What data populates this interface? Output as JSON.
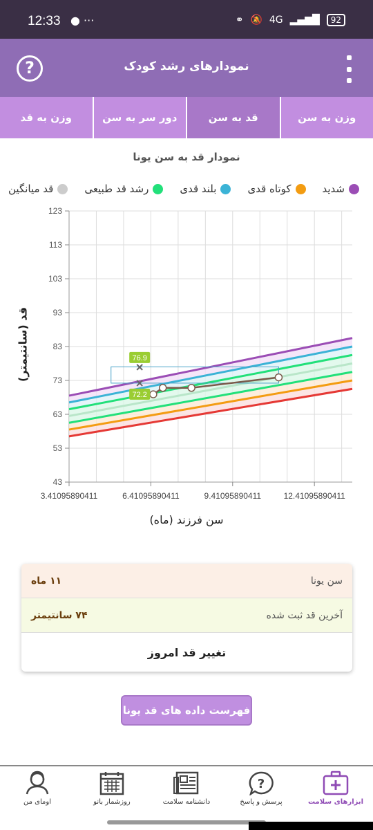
{
  "status_bar": {
    "time": "12:33",
    "left_icons": "● ···",
    "network": "4G",
    "battery": "92"
  },
  "app_bar": {
    "title": "نمودارهای رشد کودک",
    "help_glyph": "?",
    "help_icon": "help-circle-icon",
    "menu_icon": "more-vertical-icon"
  },
  "tabs": [
    {
      "label": "وزن به سن",
      "active": false
    },
    {
      "label": "قد به سن",
      "active": true
    },
    {
      "label": "دور سر به سن",
      "active": false
    },
    {
      "label": "وزن به قد",
      "active": false
    }
  ],
  "chart_title": "نمودار قد به سن یونا",
  "legend": [
    {
      "label": "شدید",
      "color": "#9b4db5"
    },
    {
      "label": "کوتاه قدی",
      "color": "#f39c12"
    },
    {
      "label": "بلند قدی",
      "color": "#3bb3d6"
    },
    {
      "label": "رشد قد طبیعی",
      "color": "#22e07a"
    },
    {
      "label": "قد میانگین",
      "color": "#cccccc"
    }
  ],
  "chart_data": {
    "type": "line",
    "xlabel": "سن فرزند (ماه)",
    "ylabel": "قد (سانتیمتر)",
    "xlim": [
      3.41095890411,
      13.8
    ],
    "ylim": [
      43,
      123
    ],
    "x_ticks": [
      "3.41095890411",
      "6.41095890411",
      "9.41095890411",
      "12.41095890411"
    ],
    "x_tick_values": [
      3.41095890411,
      6.41095890411,
      9.41095890411,
      12.41095890411
    ],
    "y_ticks": [
      43,
      53,
      63,
      73,
      83,
      93,
      103,
      113,
      123
    ],
    "grid": true,
    "reference_curves": [
      {
        "color": "#9b4db5",
        "x": [
          3.41,
          13.8
        ],
        "y": [
          68.5,
          85.5
        ]
      },
      {
        "color": "#3bb3d6",
        "x": [
          3.41,
          13.8
        ],
        "y": [
          66.5,
          83.0
        ]
      },
      {
        "color": "#22e07a",
        "x": [
          3.41,
          13.8
        ],
        "y": [
          64.5,
          80.5
        ]
      },
      {
        "color": "#b9e6c9",
        "x": [
          3.41,
          13.8
        ],
        "y": [
          62.5,
          78.0
        ]
      },
      {
        "color": "#22e07a",
        "x": [
          3.41,
          13.8
        ],
        "y": [
          60.5,
          75.5
        ]
      },
      {
        "color": "#f39c12",
        "x": [
          3.41,
          13.8
        ],
        "y": [
          58.5,
          73.0
        ]
      },
      {
        "color": "#e53935",
        "x": [
          3.41,
          13.8
        ],
        "y": [
          56.5,
          70.5
        ]
      }
    ],
    "series": [
      {
        "color": "#7a5a4a",
        "x": [
          6.5,
          6.85,
          7.9,
          11.1
        ],
        "y": [
          68.9,
          70.8,
          70.8,
          73.9
        ]
      }
    ],
    "markers": [
      {
        "label": "76.9",
        "x": 6.0,
        "y": 76.9
      },
      {
        "label": "72.2",
        "x": 6.0,
        "y": 72.2
      }
    ],
    "highlight_box": {
      "x": [
        4.95,
        11.1
      ],
      "y": [
        72.2,
        77.0
      ]
    }
  },
  "info": {
    "age_label": "سن یونا",
    "age_value": "۱۱ ماه",
    "height_label": "آخرین قد ثبت شده",
    "height_value": "۷۴ سانتیمتر",
    "change_label": "تغییر قد امروز"
  },
  "list_button": "فهرست داده های قد یونا",
  "bottom_nav": [
    {
      "label": "ابزارهای سلامت",
      "icon": "medical-kit-icon",
      "active": true
    },
    {
      "label": "پرسش و پاسخ",
      "icon": "question-bubble-icon",
      "active": false
    },
    {
      "label": "دانشنامه سلامت",
      "icon": "newspaper-icon",
      "active": false
    },
    {
      "label": "روزشمار بانو",
      "icon": "calendar-icon",
      "active": false
    },
    {
      "label": "اومای من",
      "icon": "profile-icon",
      "active": false
    }
  ]
}
